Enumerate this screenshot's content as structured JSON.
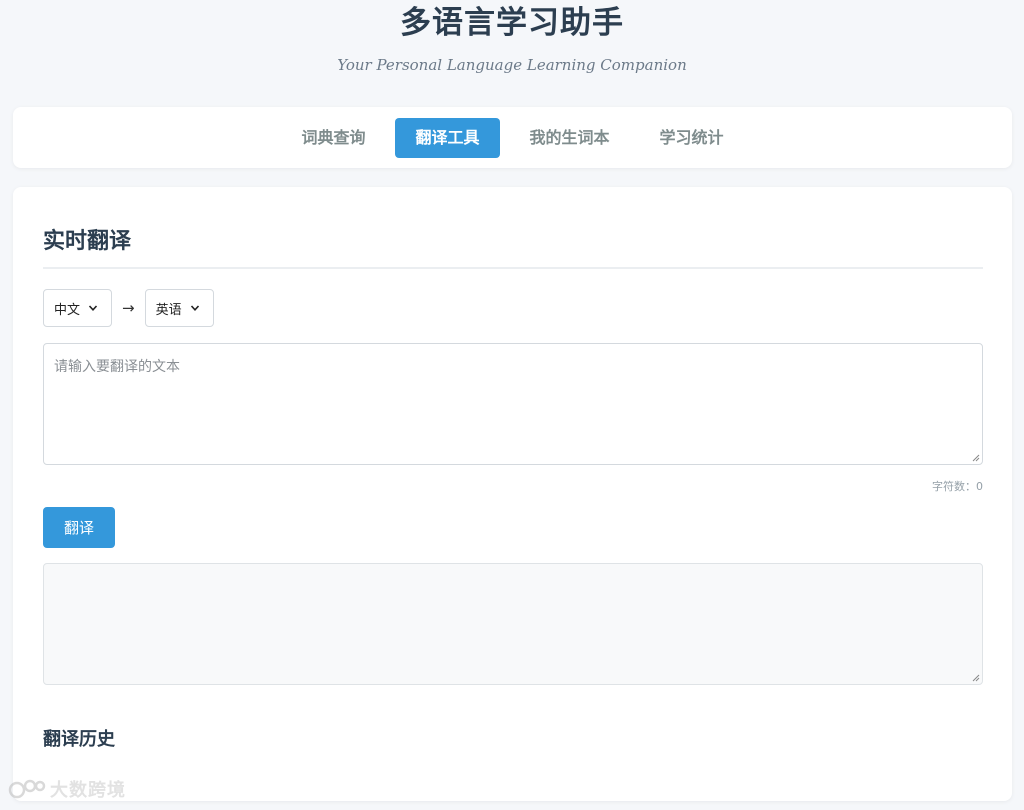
{
  "header": {
    "title": "多语言学习助手",
    "subtitle": "Your Personal Language Learning Companion"
  },
  "nav": {
    "tabs": [
      {
        "label": "词典查询",
        "active": false
      },
      {
        "label": "翻译工具",
        "active": true
      },
      {
        "label": "我的生词本",
        "active": false
      },
      {
        "label": "学习统计",
        "active": false
      }
    ]
  },
  "translate": {
    "section_title": "实时翻译",
    "source_lang": "中文",
    "arrow": "→",
    "target_lang": "英语",
    "input_placeholder": "请输入要翻译的文本",
    "char_count": "字符数：0",
    "translate_button": "翻译",
    "output_value": "",
    "history_title": "翻译历史"
  },
  "watermark": {
    "text": "大数跨境"
  },
  "colors": {
    "accent": "#3498db",
    "heading": "#2c3e50",
    "background": "#f5f7fa",
    "muted": "#7f8c8d"
  }
}
